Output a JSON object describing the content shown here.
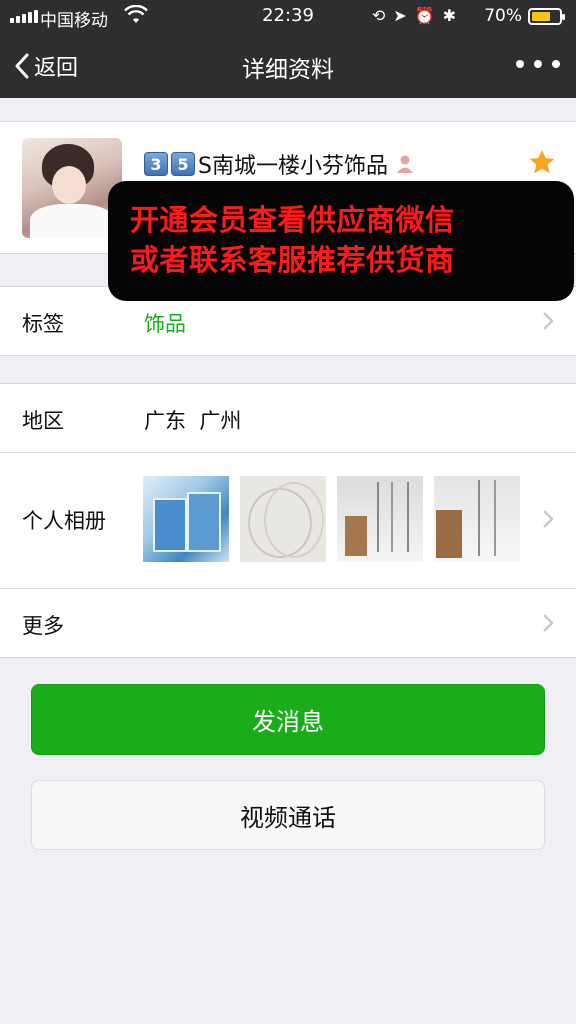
{
  "status_bar": {
    "carrier": "中国移动",
    "time": "22:39",
    "battery_percent": "70%",
    "battery_level": 0.7,
    "icons": [
      "signal-icon",
      "wifi-icon",
      "rotation-lock-icon",
      "location-icon",
      "alarm-icon",
      "bluetooth-icon",
      "battery-icon"
    ]
  },
  "nav": {
    "back_label": "返回",
    "title": "详细资料",
    "more_icon": "more-dots-icon"
  },
  "profile": {
    "badge_1": "3",
    "badge_2": "5",
    "name": "S南城一楼小芬饰品",
    "gender_icon": "female-icon",
    "star_icon": "star-icon",
    "star_color": "#f5a623"
  },
  "banner": {
    "line_1": "开通会员查看供应商微信",
    "line_2": "或者联系客服推荐供货商",
    "text_color": "#ff1a1a"
  },
  "rows": {
    "tag_label": "标签",
    "tag_value": "饰品",
    "tag_value_color": "#1aad19",
    "region_label": "地区",
    "region_value": "广东  广州",
    "album_label": "个人相册",
    "more_label": "更多"
  },
  "buttons": {
    "send_message": "发消息",
    "video_call": "视频通话"
  },
  "colors": {
    "nav_background": "#2e2e31",
    "primary_green": "#1aad19",
    "page_background": "#efeff4"
  }
}
